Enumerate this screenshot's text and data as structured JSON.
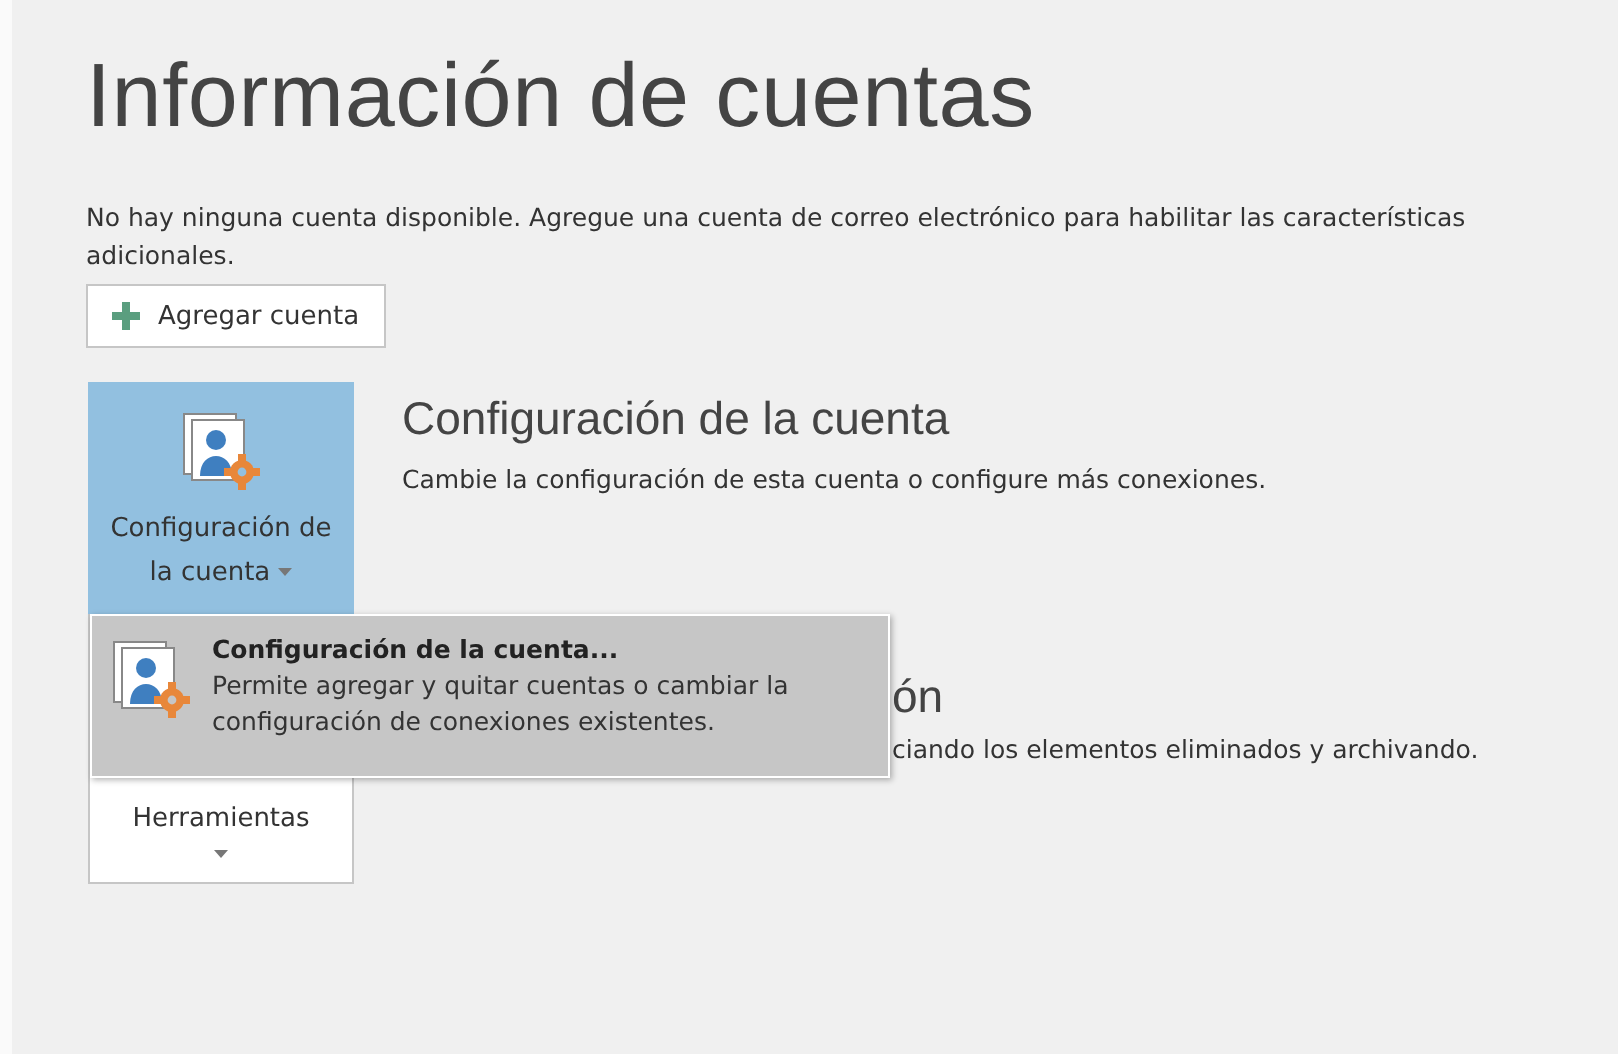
{
  "title": "Información de cuentas",
  "message": "No hay ninguna cuenta disponible. Agregue una cuenta de correo electrónico para habilitar las características adicionales.",
  "add_button": {
    "label": "Agregar cuenta"
  },
  "sections": [
    {
      "kind": "account",
      "button_label": "Configuración de la cuenta",
      "selected": true,
      "title": "Configuración de la cuenta",
      "description": "Cambie la configuración de esta cuenta o configure más conexiones."
    },
    {
      "kind": "tools",
      "button_label": "Herramientas",
      "selected": false,
      "title": "ón",
      "description": "ciando los elementos eliminados y archivando."
    }
  ],
  "menu": {
    "items": [
      {
        "title": "Configuración de la cuenta...",
        "description": "Permite agregar y quitar cuentas o cambiar la configuración de conexiones existentes.",
        "selected": true
      }
    ]
  }
}
